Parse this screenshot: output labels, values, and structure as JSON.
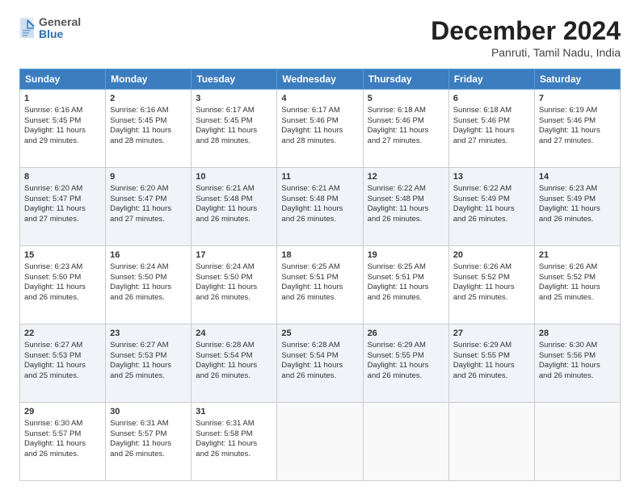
{
  "header": {
    "logo_general": "General",
    "logo_blue": "Blue",
    "month_title": "December 2024",
    "location": "Panruti, Tamil Nadu, India"
  },
  "weekdays": [
    "Sunday",
    "Monday",
    "Tuesday",
    "Wednesday",
    "Thursday",
    "Friday",
    "Saturday"
  ],
  "weeks": [
    [
      {
        "day": "1",
        "lines": [
          "Sunrise: 6:16 AM",
          "Sunset: 5:45 PM",
          "Daylight: 11 hours",
          "and 29 minutes."
        ]
      },
      {
        "day": "2",
        "lines": [
          "Sunrise: 6:16 AM",
          "Sunset: 5:45 PM",
          "Daylight: 11 hours",
          "and 28 minutes."
        ]
      },
      {
        "day": "3",
        "lines": [
          "Sunrise: 6:17 AM",
          "Sunset: 5:45 PM",
          "Daylight: 11 hours",
          "and 28 minutes."
        ]
      },
      {
        "day": "4",
        "lines": [
          "Sunrise: 6:17 AM",
          "Sunset: 5:46 PM",
          "Daylight: 11 hours",
          "and 28 minutes."
        ]
      },
      {
        "day": "5",
        "lines": [
          "Sunrise: 6:18 AM",
          "Sunset: 5:46 PM",
          "Daylight: 11 hours",
          "and 27 minutes."
        ]
      },
      {
        "day": "6",
        "lines": [
          "Sunrise: 6:18 AM",
          "Sunset: 5:46 PM",
          "Daylight: 11 hours",
          "and 27 minutes."
        ]
      },
      {
        "day": "7",
        "lines": [
          "Sunrise: 6:19 AM",
          "Sunset: 5:46 PM",
          "Daylight: 11 hours",
          "and 27 minutes."
        ]
      }
    ],
    [
      {
        "day": "8",
        "lines": [
          "Sunrise: 6:20 AM",
          "Sunset: 5:47 PM",
          "Daylight: 11 hours",
          "and 27 minutes."
        ]
      },
      {
        "day": "9",
        "lines": [
          "Sunrise: 6:20 AM",
          "Sunset: 5:47 PM",
          "Daylight: 11 hours",
          "and 27 minutes."
        ]
      },
      {
        "day": "10",
        "lines": [
          "Sunrise: 6:21 AM",
          "Sunset: 5:48 PM",
          "Daylight: 11 hours",
          "and 26 minutes."
        ]
      },
      {
        "day": "11",
        "lines": [
          "Sunrise: 6:21 AM",
          "Sunset: 5:48 PM",
          "Daylight: 11 hours",
          "and 26 minutes."
        ]
      },
      {
        "day": "12",
        "lines": [
          "Sunrise: 6:22 AM",
          "Sunset: 5:48 PM",
          "Daylight: 11 hours",
          "and 26 minutes."
        ]
      },
      {
        "day": "13",
        "lines": [
          "Sunrise: 6:22 AM",
          "Sunset: 5:49 PM",
          "Daylight: 11 hours",
          "and 26 minutes."
        ]
      },
      {
        "day": "14",
        "lines": [
          "Sunrise: 6:23 AM",
          "Sunset: 5:49 PM",
          "Daylight: 11 hours",
          "and 26 minutes."
        ]
      }
    ],
    [
      {
        "day": "15",
        "lines": [
          "Sunrise: 6:23 AM",
          "Sunset: 5:50 PM",
          "Daylight: 11 hours",
          "and 26 minutes."
        ]
      },
      {
        "day": "16",
        "lines": [
          "Sunrise: 6:24 AM",
          "Sunset: 5:50 PM",
          "Daylight: 11 hours",
          "and 26 minutes."
        ]
      },
      {
        "day": "17",
        "lines": [
          "Sunrise: 6:24 AM",
          "Sunset: 5:50 PM",
          "Daylight: 11 hours",
          "and 26 minutes."
        ]
      },
      {
        "day": "18",
        "lines": [
          "Sunrise: 6:25 AM",
          "Sunset: 5:51 PM",
          "Daylight: 11 hours",
          "and 26 minutes."
        ]
      },
      {
        "day": "19",
        "lines": [
          "Sunrise: 6:25 AM",
          "Sunset: 5:51 PM",
          "Daylight: 11 hours",
          "and 26 minutes."
        ]
      },
      {
        "day": "20",
        "lines": [
          "Sunrise: 6:26 AM",
          "Sunset: 5:52 PM",
          "Daylight: 11 hours",
          "and 25 minutes."
        ]
      },
      {
        "day": "21",
        "lines": [
          "Sunrise: 6:26 AM",
          "Sunset: 5:52 PM",
          "Daylight: 11 hours",
          "and 25 minutes."
        ]
      }
    ],
    [
      {
        "day": "22",
        "lines": [
          "Sunrise: 6:27 AM",
          "Sunset: 5:53 PM",
          "Daylight: 11 hours",
          "and 25 minutes."
        ]
      },
      {
        "day": "23",
        "lines": [
          "Sunrise: 6:27 AM",
          "Sunset: 5:53 PM",
          "Daylight: 11 hours",
          "and 25 minutes."
        ]
      },
      {
        "day": "24",
        "lines": [
          "Sunrise: 6:28 AM",
          "Sunset: 5:54 PM",
          "Daylight: 11 hours",
          "and 26 minutes."
        ]
      },
      {
        "day": "25",
        "lines": [
          "Sunrise: 6:28 AM",
          "Sunset: 5:54 PM",
          "Daylight: 11 hours",
          "and 26 minutes."
        ]
      },
      {
        "day": "26",
        "lines": [
          "Sunrise: 6:29 AM",
          "Sunset: 5:55 PM",
          "Daylight: 11 hours",
          "and 26 minutes."
        ]
      },
      {
        "day": "27",
        "lines": [
          "Sunrise: 6:29 AM",
          "Sunset: 5:55 PM",
          "Daylight: 11 hours",
          "and 26 minutes."
        ]
      },
      {
        "day": "28",
        "lines": [
          "Sunrise: 6:30 AM",
          "Sunset: 5:56 PM",
          "Daylight: 11 hours",
          "and 26 minutes."
        ]
      }
    ],
    [
      {
        "day": "29",
        "lines": [
          "Sunrise: 6:30 AM",
          "Sunset: 5:57 PM",
          "Daylight: 11 hours",
          "and 26 minutes."
        ]
      },
      {
        "day": "30",
        "lines": [
          "Sunrise: 6:31 AM",
          "Sunset: 5:57 PM",
          "Daylight: 11 hours",
          "and 26 minutes."
        ]
      },
      {
        "day": "31",
        "lines": [
          "Sunrise: 6:31 AM",
          "Sunset: 5:58 PM",
          "Daylight: 11 hours",
          "and 26 minutes."
        ]
      },
      {
        "day": "",
        "lines": []
      },
      {
        "day": "",
        "lines": []
      },
      {
        "day": "",
        "lines": []
      },
      {
        "day": "",
        "lines": []
      }
    ]
  ]
}
